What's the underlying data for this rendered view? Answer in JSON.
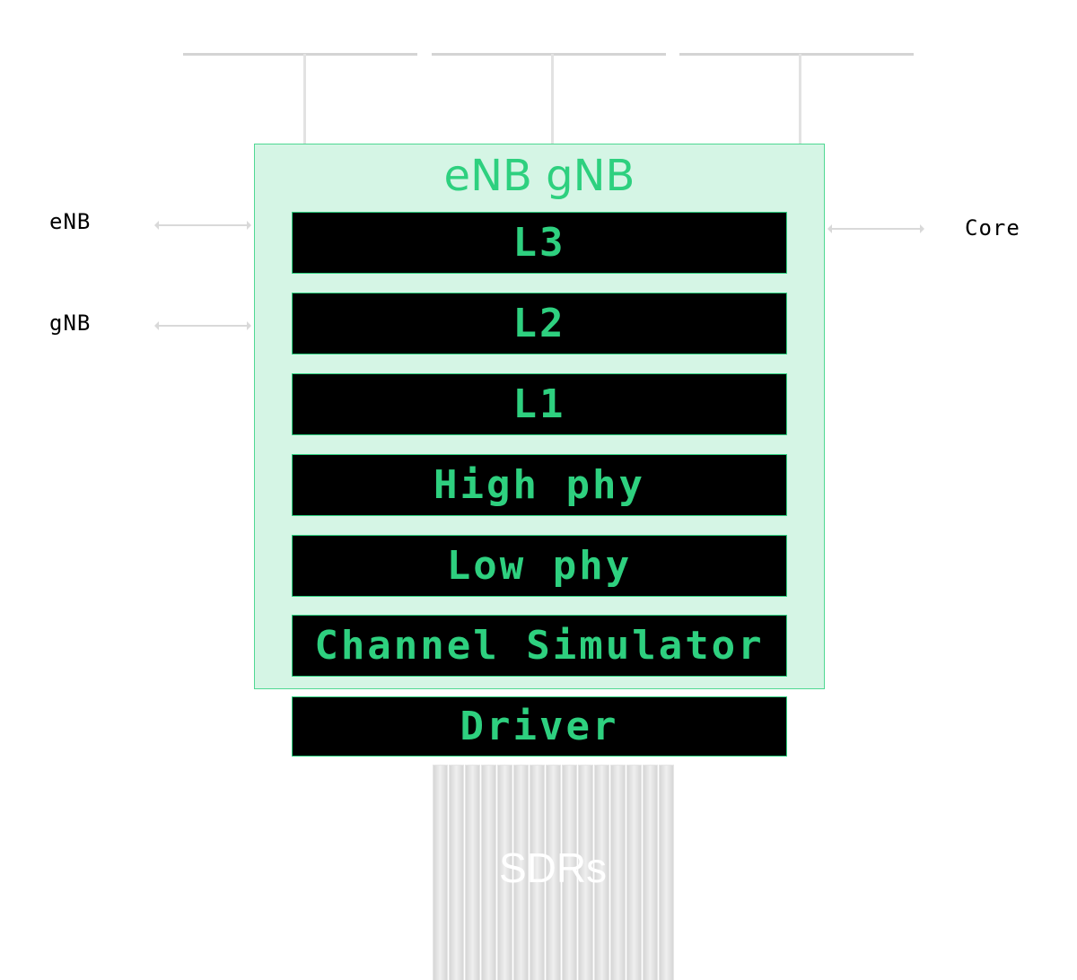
{
  "title": "eNB gNB",
  "layers": [
    "L3",
    "L2",
    "L1",
    "High phy",
    "Low phy",
    "Channel Simulator"
  ],
  "driver": "Driver",
  "left_labels": [
    "eNB",
    "gNB"
  ],
  "right_label": "Core",
  "sdr_label": "SDRs",
  "colors": {
    "accent": "#2ed07f",
    "container": "#d5f5e5",
    "layer_bg": "#000000",
    "lines": "#d4d4d4"
  }
}
